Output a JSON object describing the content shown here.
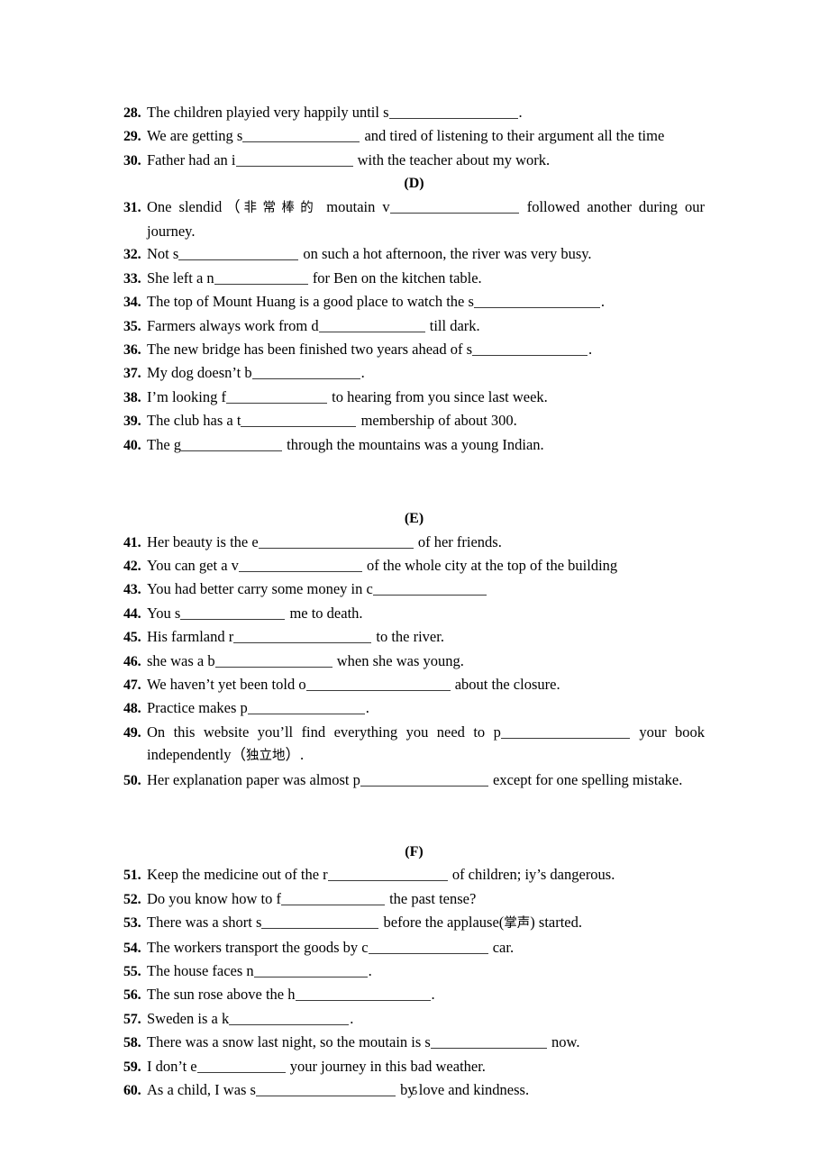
{
  "document": {
    "page_number": "5",
    "type": "english-worksheet-fill-in-the-blank"
  },
  "sections": [
    {
      "heading": null,
      "items": [
        {
          "number": "28.",
          "pre": "The children playied very happily until s",
          "blank_width": 143,
          "post": "."
        },
        {
          "number": "29.",
          "pre": "We are getting s",
          "blank_width": 130,
          "post": " and tired of listening to their argument all the time"
        },
        {
          "number": "30.",
          "pre": "Father had an i",
          "blank_width": 130,
          "post": " with the teacher about my work."
        }
      ]
    },
    {
      "heading": "(D)",
      "items": [
        {
          "number": "31.",
          "line1_pre": "One slendid（",
          "line1_cn": "非常棒的",
          "line1_mid": "moutain v",
          "blank_width": 143,
          "line1_post": "followed another during our",
          "line2": "journey."
        },
        {
          "number": "32.",
          "pre": "Not s",
          "blank_width": 133,
          "post": " on such a hot afternoon, the river was very busy."
        },
        {
          "number": "33.",
          "pre": "She left a n",
          "blank_width": 104,
          "post": " for Ben on the kitchen table."
        },
        {
          "number": "34.",
          "pre": "The top of Mount Huang is a good place to watch the s",
          "blank_width": 140,
          "post": "."
        },
        {
          "number": "35.",
          "pre": "Farmers always work from d",
          "blank_width": 118,
          "post": " till dark."
        },
        {
          "number": "36.",
          "pre": "The new bridge has been finished two years ahead of s",
          "blank_width": 128,
          "post": "."
        },
        {
          "number": "37.",
          "pre": "My dog doesn’t b",
          "blank_width": 120,
          "post": "."
        },
        {
          "number": "38.",
          "pre": "I’m looking f",
          "blank_width": 112,
          "post": " to hearing from you since last week."
        },
        {
          "number": "39.",
          "pre": "The club has a t",
          "blank_width": 128,
          "post": " membership of about 300."
        },
        {
          "number": "40.",
          "pre": "The g",
          "blank_width": 112,
          "post": " through the mountains was a young Indian."
        }
      ]
    },
    {
      "heading": "(E)",
      "items": [
        {
          "number": "41.",
          "pre": "Her beauty is the e",
          "blank_width": 172,
          "post": " of her friends."
        },
        {
          "number": "42.",
          "pre": "You can get a v",
          "blank_width": 137,
          "post": " of the whole city at the top of the building"
        },
        {
          "number": "43.",
          "pre": "You had better carry some money in c",
          "blank_width": 126,
          "post": ""
        },
        {
          "number": "44.",
          "pre": "You s",
          "blank_width": 116,
          "post": " me to death."
        },
        {
          "number": "45.",
          "pre": "His farmland r",
          "blank_width": 153,
          "post": " to the river."
        },
        {
          "number": "46.",
          "pre": "she was a b",
          "blank_width": 130,
          "post": " when she was young."
        },
        {
          "number": "47.",
          "pre": "We haven’t yet been told o",
          "blank_width": 160,
          "post": " about the closure."
        },
        {
          "number": "48.",
          "pre": "Practice makes p",
          "blank_width": 130,
          "post": "."
        },
        {
          "number": "49.",
          "line1_pre": "On this website you’ll find everything you need to p",
          "blank_width": 143,
          "line1_post": "your book",
          "line2_pre": "independently（",
          "line2_cn": "独立地",
          "line2_post": "）."
        },
        {
          "number": "50.",
          "pre": "Her explanation paper was almost p",
          "blank_width": 142,
          "post": " except for one spelling mistake."
        }
      ]
    },
    {
      "heading": "(F)",
      "items": [
        {
          "number": "51.",
          "pre": "Keep the medicine out of the r",
          "blank_width": 133,
          "post": " of children; iy’s dangerous."
        },
        {
          "number": "52.",
          "pre": "Do you know how to f",
          "blank_width": 115,
          "post": " the past tense?"
        },
        {
          "number": "53.",
          "pre": "There was a short s",
          "blank_width": 130,
          "post_a": " before the applause(",
          "post_cn": "掌声",
          "post_b": ") started."
        },
        {
          "number": "54.",
          "pre": "The workers transport the goods by c",
          "blank_width": 133,
          "post": " car."
        },
        {
          "number": "55.",
          "pre": "The house faces n",
          "blank_width": 126,
          "post": "."
        },
        {
          "number": "56.",
          "pre": "The sun rose above the h",
          "blank_width": 150,
          "post": "."
        },
        {
          "number": "57.",
          "pre": "Sweden is a k",
          "blank_width": 133,
          "post": "."
        },
        {
          "number": "58.",
          "pre": "There was a snow last night, so the moutain is s",
          "blank_width": 129,
          "post": " now."
        },
        {
          "number": "59.",
          "pre": "I don’t e",
          "blank_width": 98,
          "post": " your journey in this bad weather."
        },
        {
          "number": "60.",
          "pre": "As a child, I was s",
          "blank_width": 155,
          "post": " by love and kindness."
        }
      ]
    }
  ]
}
